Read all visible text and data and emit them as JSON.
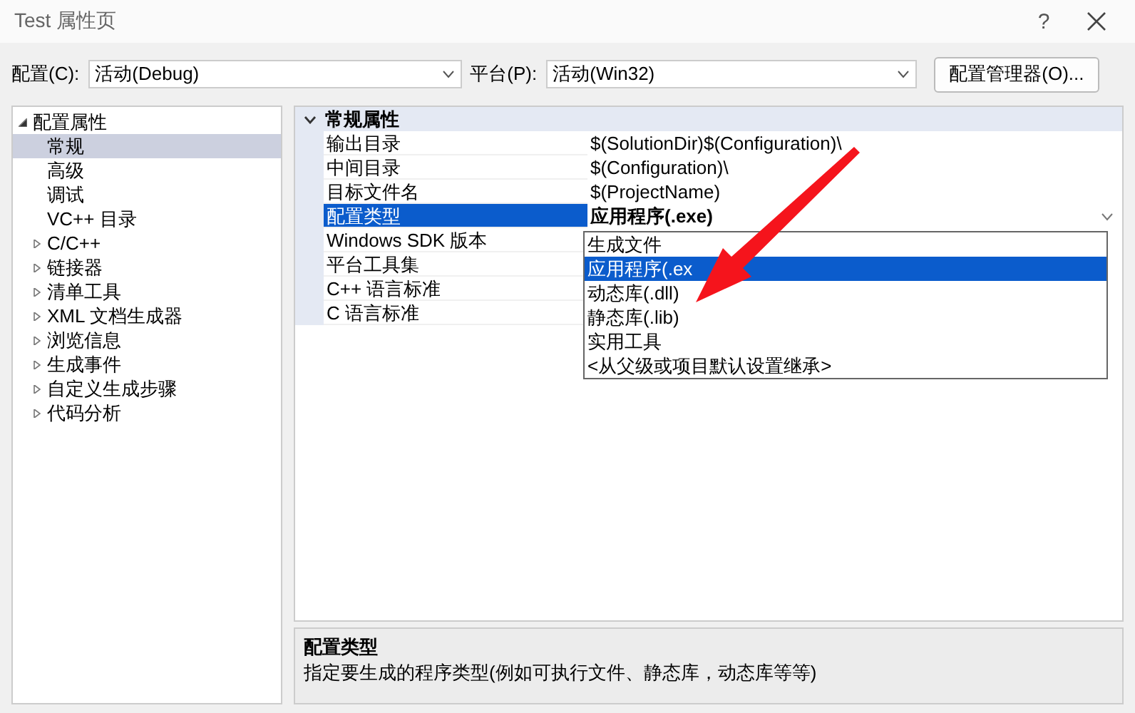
{
  "window": {
    "title": "Test 属性页",
    "help": "?"
  },
  "toolbar": {
    "config_label": "配置(C):",
    "config_value": "活动(Debug)",
    "platform_label": "平台(P):",
    "platform_value": "活动(Win32)",
    "manager_button": "配置管理器(O)..."
  },
  "tree": [
    {
      "label": "配置属性",
      "expanded": true,
      "selected": false,
      "children": [
        {
          "label": "常规",
          "selected": true
        },
        {
          "label": "高级",
          "selected": false
        },
        {
          "label": "调试",
          "selected": false
        },
        {
          "label": "VC++ 目录",
          "selected": false
        },
        {
          "label": "C/C++",
          "selected": false,
          "expanded": false
        },
        {
          "label": "链接器",
          "selected": false,
          "expanded": false
        },
        {
          "label": "清单工具",
          "selected": false,
          "expanded": false
        },
        {
          "label": "XML 文档生成器",
          "selected": false,
          "expanded": false
        },
        {
          "label": "浏览信息",
          "selected": false,
          "expanded": false
        },
        {
          "label": "生成事件",
          "selected": false,
          "expanded": false
        },
        {
          "label": "自定义生成步骤",
          "selected": false,
          "expanded": false
        },
        {
          "label": "代码分析",
          "selected": false,
          "expanded": false
        }
      ]
    }
  ],
  "grid": {
    "section": {
      "label": "常规属性",
      "expanded": true
    },
    "rows": [
      {
        "name": "输出目录",
        "value": "$(SolutionDir)$(Configuration)\\",
        "selected": false
      },
      {
        "name": "中间目录",
        "value": "$(Configuration)\\",
        "selected": false
      },
      {
        "name": "目标文件名",
        "value": "$(ProjectName)",
        "selected": false
      },
      {
        "name": "配置类型",
        "value": "应用程序(.exe)",
        "selected": true,
        "kind": "dropdown"
      },
      {
        "name": "Windows SDK 版本",
        "selected": false
      },
      {
        "name": "平台工具集",
        "selected": false
      },
      {
        "name": "C++ 语言标准",
        "selected": false
      },
      {
        "name": "C 语言标准",
        "selected": false
      }
    ]
  },
  "dropdown": {
    "items": [
      {
        "label": "生成文件",
        "selected": false
      },
      {
        "label": "应用程序(.ex",
        "selected": true
      },
      {
        "label": "动态库(.dll)",
        "selected": false
      },
      {
        "label": "静态库(.lib)",
        "selected": false
      },
      {
        "label": "实用工具",
        "selected": false
      },
      {
        "label": "<从父级或项目默认设置继承>",
        "selected": false
      }
    ]
  },
  "description": {
    "title": "配置类型",
    "text": "指定要生成的程序类型(例如可执行文件、静态库，动态库等等)"
  }
}
